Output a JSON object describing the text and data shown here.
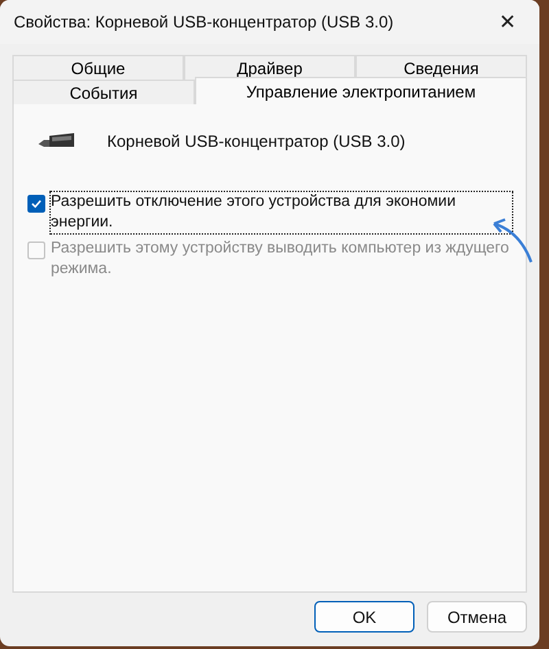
{
  "window": {
    "title": "Свойства: Корневой USB-концентратор (USB 3.0)",
    "close": "✕"
  },
  "tab_rows": [
    [
      {
        "label": "Общие",
        "selected": false
      },
      {
        "label": "Драйвер",
        "selected": false
      },
      {
        "label": "Сведения",
        "selected": false
      }
    ],
    [
      {
        "label": "События",
        "selected": false
      },
      {
        "label": "Управление электропитанием",
        "selected": true
      }
    ]
  ],
  "device": {
    "name": "Корневой USB-концентратор (USB 3.0)"
  },
  "options": [
    {
      "label": "Разрешить отключение этого устройства для экономии энергии.",
      "checked": true,
      "disabled": false,
      "focused": true
    },
    {
      "label": "Разрешить этому устройству выводить компьютер из ждущего режима.",
      "checked": false,
      "disabled": true,
      "focused": false
    }
  ],
  "buttons": [
    {
      "label": "OK",
      "default": true
    },
    {
      "label": "Отмена",
      "default": false
    }
  ]
}
